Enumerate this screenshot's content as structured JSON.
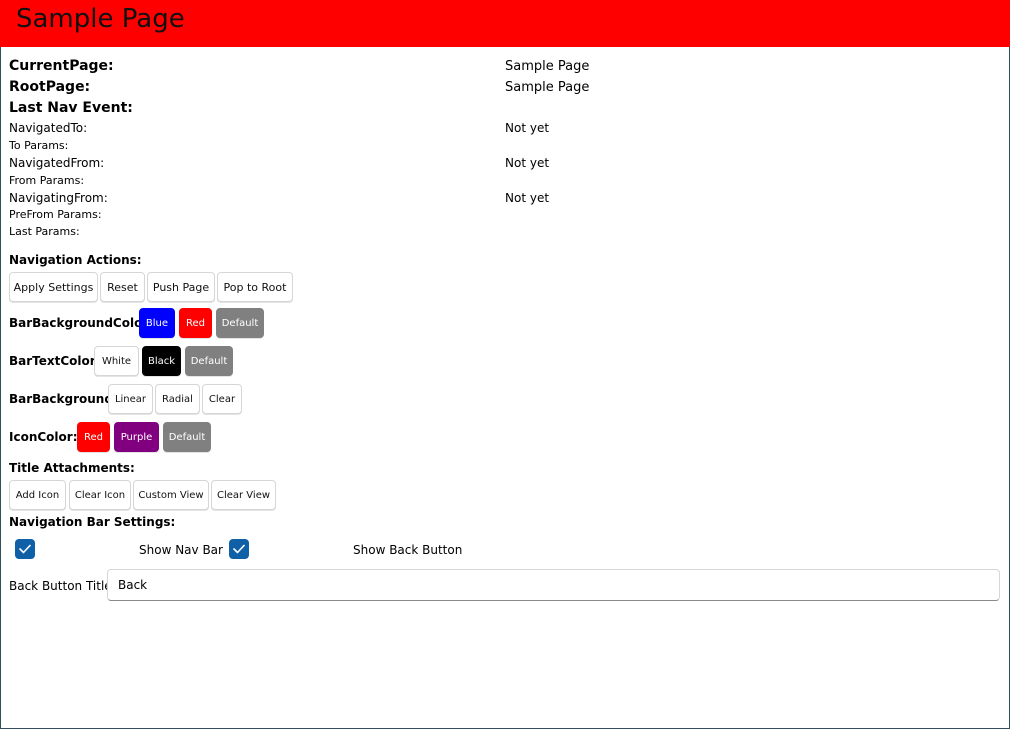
{
  "page": {
    "title": "Sample Page"
  },
  "info": {
    "current_page_label": "CurrentPage:",
    "current_page_value": "Sample Page",
    "root_page_label": "RootPage:",
    "root_page_value": "Sample Page",
    "last_nav_event_label": "Last Nav Event:",
    "navigated_to_label": "NavigatedTo:",
    "navigated_to_value": "Not yet",
    "to_params_label": "To Params:",
    "navigated_from_label": "NavigatedFrom:",
    "navigated_from_value": "Not yet",
    "from_params_label": "From Params:",
    "navigating_from_label": "NavigatingFrom:",
    "navigating_from_value": "Not yet",
    "prefrom_params_label": "PreFrom Params:",
    "last_params_label": "Last Params:"
  },
  "navigation_actions": {
    "label": "Navigation Actions:",
    "apply_settings": "Apply Settings",
    "reset": "Reset",
    "push_page": "Push Page",
    "pop_to_root": "Pop to Root"
  },
  "bar_background_color": {
    "label": "BarBackgroundColor:",
    "blue": "Blue",
    "red": "Red",
    "default": "Default"
  },
  "bar_text_color": {
    "label": "BarTextColor:",
    "white": "White",
    "black": "Black",
    "default": "Default"
  },
  "bar_background": {
    "label": "BarBackground:",
    "linear": "Linear",
    "radial": "Radial",
    "clear": "Clear"
  },
  "icon_color": {
    "label": "IconColor:",
    "red": "Red",
    "purple": "Purple",
    "default": "Default"
  },
  "title_attachments": {
    "label": "Title Attachments:",
    "add_icon": "Add Icon",
    "clear_icon": "Clear Icon",
    "custom_view": "Custom View",
    "clear_view": "Clear View"
  },
  "nav_bar_settings": {
    "label": "Navigation Bar Settings:",
    "show_nav_bar": "Show Nav Bar",
    "show_nav_bar_checked": true,
    "show_back_button": "Show Back Button",
    "show_back_button_checked": true
  },
  "back_button": {
    "label": "Back Button Title:",
    "value": "Back"
  },
  "colors": {
    "navbar": "#ff0000",
    "checkbox": "#1060a8"
  }
}
